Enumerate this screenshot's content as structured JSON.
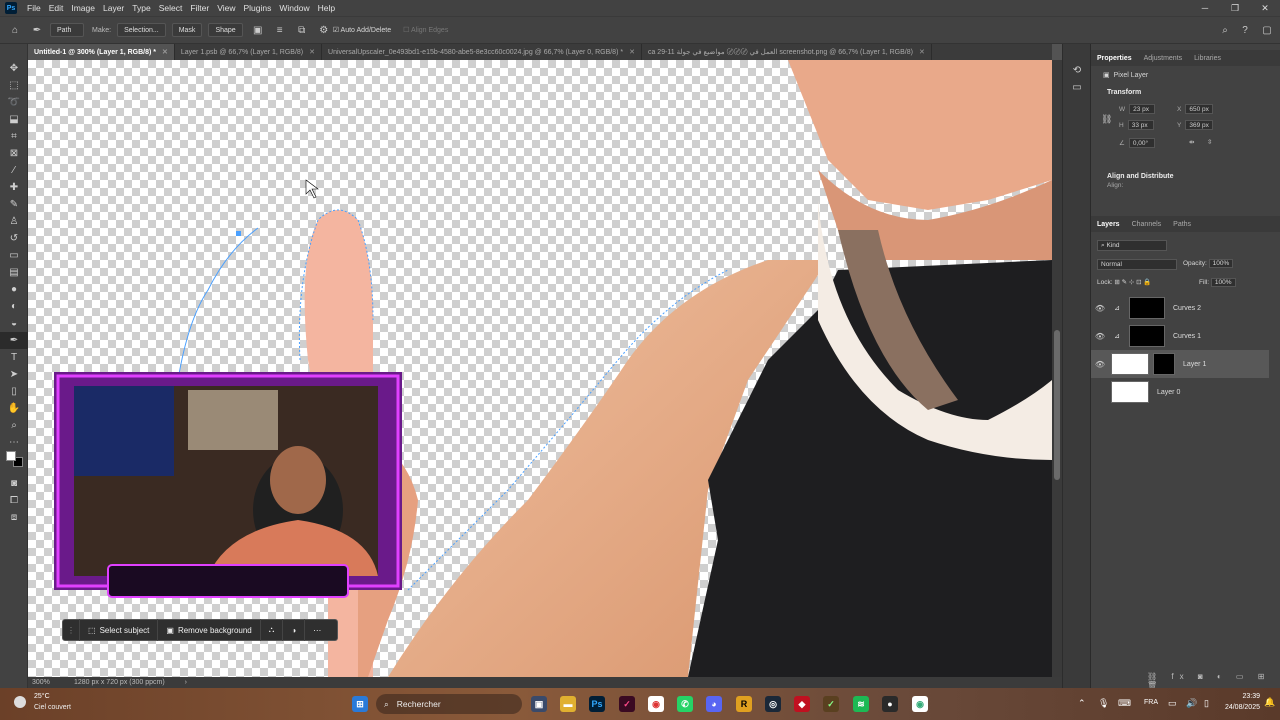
{
  "app": {
    "logo": "Ps",
    "brand_color": "#31a8ff"
  },
  "menu": [
    "File",
    "Edit",
    "Image",
    "Layer",
    "Type",
    "Select",
    "Filter",
    "View",
    "Plugins",
    "Window",
    "Help"
  ],
  "options_bar": {
    "mode": "Path",
    "make_label": "Make:",
    "selection_button": "Selection...",
    "mask_button": "Mask",
    "shape_button": "Shape",
    "auto_add_delete": "Auto Add/Delete",
    "align_edges": "Align Edges"
  },
  "tabs": [
    {
      "label": "Untitled-1 @ 300% (Layer 1, RGB/8) *",
      "active": true
    },
    {
      "label": "Layer 1.psb @ 66,7% (Layer 1, RGB/8)",
      "active": false
    },
    {
      "label": "UniversalUpscaler_0e493bd1-e15b-4580-abe5-8e3cc60c0024.jpg @ 66,7% (Layer 0, RGB/8) *",
      "active": false
    },
    {
      "label": "ca 29-11 العمل في 〄〄〄 مواضيع في جولة screenshot.png @ 66,7% (Layer 1, RGB/8)",
      "active": false
    }
  ],
  "status": {
    "zoom": "300%",
    "doc_size": "1280 px x 720 px (300 ppcm)"
  },
  "context_bar": {
    "select_subject": "Select subject",
    "remove_background": "Remove background"
  },
  "properties": {
    "tabs": [
      "Properties",
      "Adjustments",
      "Libraries"
    ],
    "kind": "Pixel Layer",
    "transform_title": "Transform",
    "w_label": "W",
    "w": "23 px",
    "h_label": "H",
    "h": "33 px",
    "x_label": "X",
    "x": "650 px",
    "y_label": "Y",
    "y": "369 px",
    "angle": "0,00°",
    "align_title": "Align and Distribute",
    "align_label": "Align:"
  },
  "layers_panel": {
    "tabs": [
      "Layers",
      "Channels",
      "Paths"
    ],
    "filter": "Kind",
    "blend": "Normal",
    "opacity_label": "Opacity:",
    "opacity": "100%",
    "lock_label": "Lock:",
    "fill_label": "Fill:",
    "fill": "100%",
    "layers": [
      {
        "name": "Curves 2",
        "visible": true,
        "selected": false
      },
      {
        "name": "Curves 1",
        "visible": true,
        "selected": false
      },
      {
        "name": "Layer 1",
        "visible": true,
        "selected": true
      },
      {
        "name": "Layer 0",
        "visible": false,
        "selected": false
      }
    ]
  },
  "taskbar": {
    "weather_temp": "25°C",
    "weather_desc": "Ciel couvert",
    "search_placeholder": "Rechercher",
    "lang": "FRA",
    "time": "23:39",
    "date": "24/08/2025"
  }
}
